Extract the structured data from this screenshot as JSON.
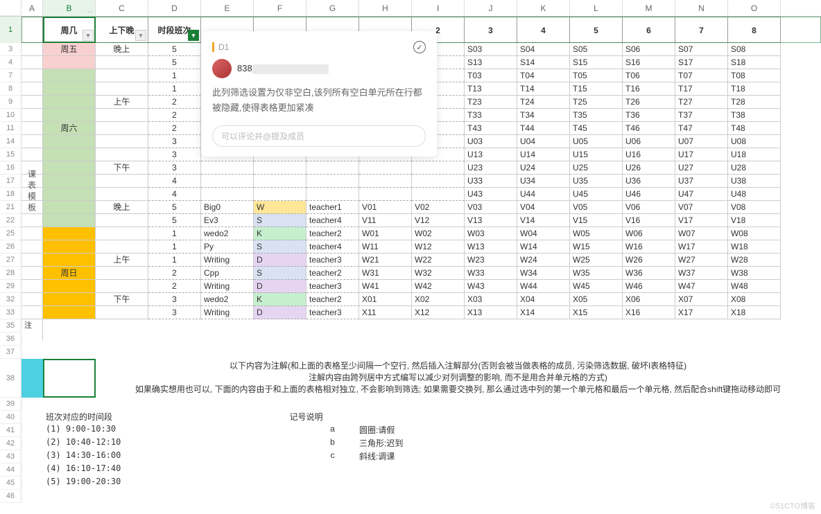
{
  "columns": [
    "A",
    "B",
    "C",
    "D",
    "E",
    "F",
    "G",
    "H",
    "I",
    "J",
    "K",
    "L",
    "M",
    "N",
    "O"
  ],
  "colMenu": "...",
  "colWidths": {
    "rowHead": 31,
    "A": 31,
    "B": 76,
    "C": 76,
    "D": 76,
    "E": 76,
    "F": 76,
    "G": 76,
    "H": 76,
    "I": 76,
    "J": 76,
    "K": 76,
    "L": 76,
    "M": 76,
    "N": 76,
    "O": 76
  },
  "rowLabels": [
    "1",
    "3",
    "4",
    "7",
    "8",
    "9",
    "10",
    "11",
    "14",
    "15",
    "16",
    "17",
    "18",
    "21",
    "22",
    "25",
    "26",
    "27",
    "28",
    "29",
    "32",
    "33",
    "35",
    "36",
    "37",
    "38",
    "39",
    "40",
    "41",
    "42",
    "43",
    "44",
    "45",
    "46"
  ],
  "header": {
    "B": "周几",
    "C": "上下晚",
    "D": "时段班次",
    "I": "2",
    "J": "3",
    "K": "4",
    "L": "5",
    "M": "6",
    "N": "7",
    "O": "8"
  },
  "sidebar": {
    "vLabel": "课表模板"
  },
  "blocks": {
    "friday": {
      "label": "周五",
      "session": "晚上",
      "rows": [
        {
          "d": "5"
        },
        {
          "d": "5"
        }
      ]
    },
    "saturday": {
      "label": "周六",
      "morning": {
        "label": "上午",
        "rows": [
          {
            "d": "1"
          },
          {
            "d": "1"
          },
          {
            "d": "2"
          },
          {
            "d": "2"
          },
          {
            "d": "2"
          }
        ]
      },
      "afternoon": {
        "label": "下午",
        "rows": [
          {
            "d": "3"
          },
          {
            "d": "3"
          },
          {
            "d": "3"
          },
          {
            "d": "4"
          },
          {
            "d": "4"
          }
        ]
      },
      "evening": {
        "label": "晚上",
        "rows": [
          {
            "d": "5",
            "e": "Big0",
            "f": "W",
            "fbg": "yellow",
            "g": "teacher1",
            "cells": [
              "V01",
              "V02",
              "V03",
              "V04",
              "V05",
              "V06",
              "V07",
              "V08"
            ]
          },
          {
            "d": "5",
            "e": "Ev3",
            "f": "S",
            "fbg": "lblue",
            "g": "teacher4",
            "cells": [
              "V11",
              "V12",
              "V13",
              "V14",
              "V15",
              "V16",
              "V17",
              "V18"
            ]
          }
        ]
      }
    },
    "sunday": {
      "label": "周日",
      "morning": {
        "label": "上午",
        "rows": [
          {
            "d": "1",
            "e": "wedo2",
            "f": "K",
            "fbg": "lgreen",
            "g": "teacher2",
            "cells": [
              "W01",
              "W02",
              "W03",
              "W04",
              "W05",
              "W06",
              "W07",
              "W08"
            ]
          },
          {
            "d": "1",
            "e": "Py",
            "f": "S",
            "fbg": "lblue",
            "g": "teacher4",
            "cells": [
              "W11",
              "W12",
              "W13",
              "W14",
              "W15",
              "W16",
              "W17",
              "W18"
            ]
          },
          {
            "d": "1",
            "e": "Writing",
            "f": "D",
            "fbg": "lpurple",
            "g": "teacher3",
            "cells": [
              "W21",
              "W22",
              "W23",
              "W24",
              "W25",
              "W26",
              "W27",
              "W28"
            ]
          },
          {
            "d": "2",
            "e": "Cpp",
            "f": "S",
            "fbg": "lblue",
            "g": "teacher2",
            "cells": [
              "W31",
              "W32",
              "W33",
              "W34",
              "W35",
              "W36",
              "W37",
              "W38"
            ]
          },
          {
            "d": "2",
            "e": "Writing",
            "f": "D",
            "fbg": "lpurple",
            "g": "teacher3",
            "cells": [
              "W41",
              "W42",
              "W43",
              "W44",
              "W45",
              "W46",
              "W47",
              "W48"
            ]
          }
        ]
      },
      "afternoon": {
        "label": "下午",
        "rows": [
          {
            "d": "3",
            "e": "wedo2",
            "f": "K",
            "fbg": "lgreen",
            "g": "teacher2",
            "cells": [
              "X01",
              "X02",
              "X03",
              "X04",
              "X05",
              "X06",
              "X07",
              "X08"
            ]
          },
          {
            "d": "3",
            "e": "Writing",
            "f": "D",
            "fbg": "lpurple",
            "g": "teacher3",
            "cells": [
              "X11",
              "X12",
              "X13",
              "X14",
              "X15",
              "X16",
              "X17",
              "X18"
            ]
          }
        ]
      }
    }
  },
  "rightCells": {
    "3": [
      "S03",
      "S04",
      "S05",
      "S06",
      "S07",
      "S08"
    ],
    "4": [
      "S13",
      "S14",
      "S15",
      "S16",
      "S17",
      "S18"
    ],
    "7": [
      "T03",
      "T04",
      "T05",
      "T06",
      "T07",
      "T08"
    ],
    "8": [
      "T13",
      "T14",
      "T15",
      "T16",
      "T17",
      "T18"
    ],
    "9": [
      "T23",
      "T24",
      "T25",
      "T26",
      "T27",
      "T28"
    ],
    "10": [
      "T33",
      "T34",
      "T35",
      "T36",
      "T37",
      "T38"
    ],
    "11": [
      "T43",
      "T44",
      "T45",
      "T46",
      "T47",
      "T48"
    ],
    "14": [
      "U03",
      "U04",
      "U05",
      "U06",
      "U07",
      "U08"
    ],
    "15": [
      "U13",
      "U14",
      "U15",
      "U16",
      "U17",
      "U18"
    ],
    "16": [
      "U23",
      "U24",
      "U25",
      "U26",
      "U27",
      "U28"
    ],
    "17": [
      "U33",
      "U34",
      "U35",
      "U36",
      "U37",
      "U38"
    ],
    "18": [
      "U43",
      "U44",
      "U45",
      "U46",
      "U47",
      "U48"
    ]
  },
  "notes": {
    "r35A": "注",
    "r38": "以下内容为注解(和上面的表格至少间隔一个空行, 然后插入注解部分(否则会被当做表格的成员, 污染筛选数据, 破坏I表格特征)\n注解内容由跨列居中方式编写以减少对列调整的影响, 而不是用合并单元格的方式)\n如果确实想用也可以, 下面的内容由于和上面的表格相对独立, 不会影响到筛选; 如果需要交换列, 那么通过选中列的第一个单元格和最后一个单元格, 然后配合shift键拖动移动即可",
    "r40_left": "班次对应的时间段",
    "r40_mid": "记号说明",
    "timeSlots": [
      {
        "idx": "(1) 9:00-10:30",
        "sym": "a",
        "expl": "圆圈:请假"
      },
      {
        "idx": "(2) 10:40-12:10",
        "sym": "b",
        "expl": "三角形:迟到"
      },
      {
        "idx": "(3) 14:30-16:00",
        "sym": "c",
        "expl": "斜线:调课"
      },
      {
        "idx": "(4) 16:10-17:40"
      },
      {
        "idx": "(5) 19:00-20:30"
      }
    ]
  },
  "comment": {
    "cellRef": "D1",
    "userName": "838",
    "body": "此列筛选设置为仅非空白,该列所有空白单元所在行都被隐藏,使得表格更加紧凑",
    "replyPlaceholder": "可以评论并@提及成员"
  },
  "watermark": "©51CTO博客"
}
